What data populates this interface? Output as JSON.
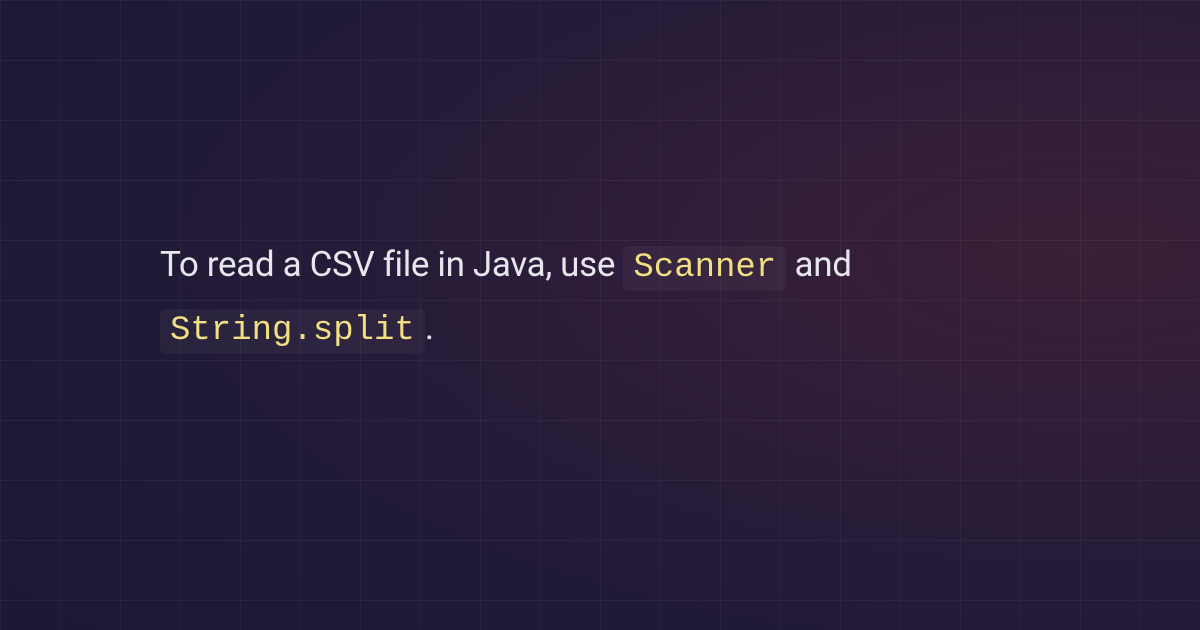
{
  "sentence": {
    "part1": "To read a CSV file in Java, use ",
    "code1": "Scanner",
    "part2": " and ",
    "code2": "String.split",
    "part3": "."
  }
}
